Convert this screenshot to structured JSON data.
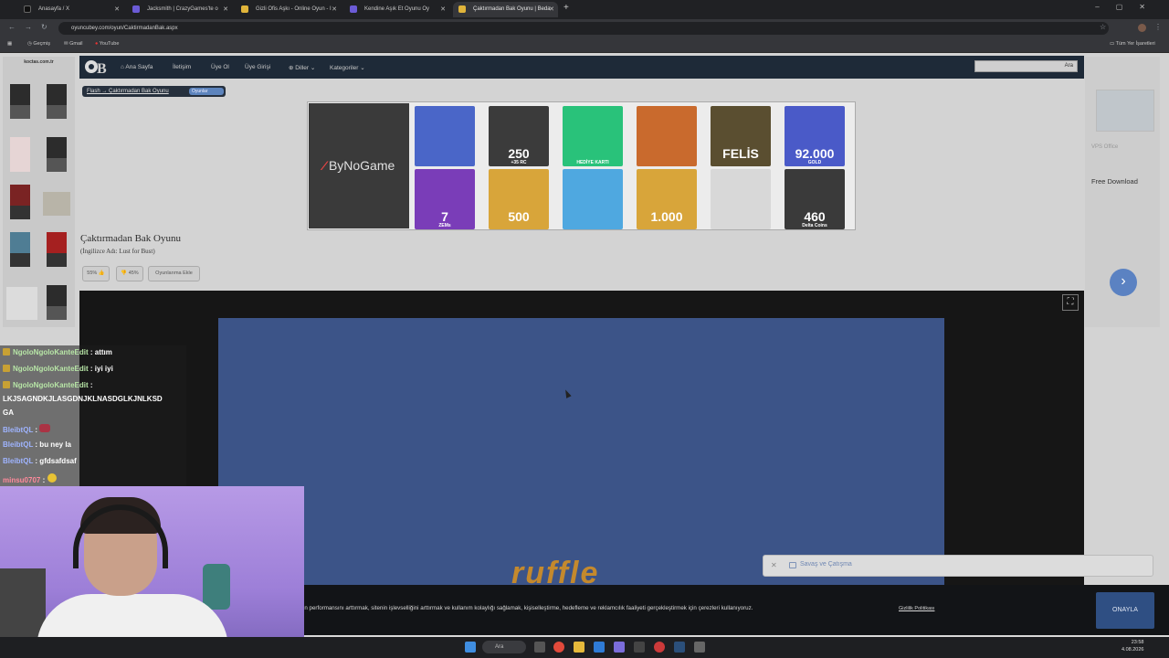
{
  "browser": {
    "tabs": [
      {
        "label": "Anasayfa / X",
        "favicon_color": "#111111"
      },
      {
        "label": "Jacksmith | CrazyGames'te o",
        "favicon_color": "#6b5bd6"
      },
      {
        "label": "Gizli Ofis Aşkı - Online Oyun - I",
        "favicon_color": "#e0b43a"
      },
      {
        "label": "Kendine Aşık Et Oyunu Oy",
        "favicon_color": "#6b5bd6"
      },
      {
        "label": "Çaktırmadan Bak Oyunu | Beda",
        "favicon_color": "#e0b43a"
      }
    ],
    "url": "oyuncubey.com/oyun/CaktirmadanBak.aspx",
    "bookmarks": [
      "Geçmiş",
      "Gmail",
      "YouTube"
    ],
    "bookmarks_right": "Tüm Yer İşaretleri"
  },
  "site": {
    "nav": [
      "Ana Sayfa",
      "İletişim",
      "Üye Ol",
      "Üye Girişi",
      "Diller",
      "Kategoriler"
    ],
    "search_button": "Ara",
    "breadcrumb": "Flash → Çaktırmadan Bak Oyunu",
    "breadcrumb_badge": "Oyunlar",
    "left_ad_brand": "koctas.com.tr",
    "right_ad": {
      "label": "VPS Office",
      "download": "Free Download"
    }
  },
  "banner": {
    "brand": "ByNoGame",
    "tiles": [
      {
        "label": "",
        "sub": "",
        "color": "#4a66c8"
      },
      {
        "label": "250",
        "sub": "+35 RC",
        "color": "#3b3b3b"
      },
      {
        "label": "",
        "sub": "HEDİYE KARTI",
        "color": "#29c27a"
      },
      {
        "label": "",
        "sub": "",
        "color": "#c96a2d"
      },
      {
        "label": "FELİS",
        "sub": "",
        "color": "#5a4e30"
      },
      {
        "label": "92.000",
        "sub": "GOLD",
        "color": "#4a5ac8"
      },
      {
        "label": "7",
        "sub": "ZEMs",
        "color": "#7a3db8"
      },
      {
        "label": "500",
        "sub": "",
        "color": "#d8a53a"
      },
      {
        "label": "",
        "sub": "",
        "color": "#4fa8e0"
      },
      {
        "label": "1.000",
        "sub": "",
        "color": "#d8a53a"
      },
      {
        "label": "",
        "sub": "",
        "color": "#d8d8d8"
      },
      {
        "label": "460",
        "sub": "Delta Coins",
        "color": "#3a3a3a"
      }
    ]
  },
  "game": {
    "title": "Çaktırmadan Bak Oyunu",
    "subtitle": "(İngilizce Adı: Lust for Bust)",
    "like": "55%",
    "dislike": "45%",
    "add_button": "Oyunlarıma Ekle",
    "player_logo": "ruffle"
  },
  "toast": {
    "label": "Savaş ve Çatışma"
  },
  "cookie": {
    "text": "in performansını arttırmak, sitenin işlevselliğini arttırmak ve kullanım kolaylığı sağlamak, kişiselleştirme, hedefleme ve reklamcılık faaliyeti gerçekleştirmek için çerezleri kullanıyoruz.",
    "link": "Gizlilik Politikası",
    "accept": "ONAYLA"
  },
  "chat": [
    {
      "user": "NgoloNgoloKanteEdit",
      "msg": ": attım",
      "badge": true
    },
    {
      "user": "NgoloNgoloKanteEdit",
      "msg": ": iyi iyi",
      "badge": true
    },
    {
      "user": "NgoloNgoloKanteEdit",
      "msg": " :",
      "badge": true
    },
    {
      "user": "",
      "msg": "LKJSAGNDKJLASGDNJKLNASDGLKJNLKSD",
      "badge": false
    },
    {
      "user": "",
      "msg": "GA",
      "badge": false
    },
    {
      "user": "BleibtQL",
      "msg": ":",
      "badge": false
    },
    {
      "user": "BleibtQL",
      "msg": ": bu ney la",
      "badge": false
    },
    {
      "user": "BleibtQL",
      "msg": ": gfdsafdsaf",
      "badge": false
    },
    {
      "user": "minsu0707",
      "msg": ":",
      "badge": false
    }
  ],
  "taskbar": {
    "search": "Ara",
    "time": "23:58",
    "date": "4.08.2026"
  }
}
